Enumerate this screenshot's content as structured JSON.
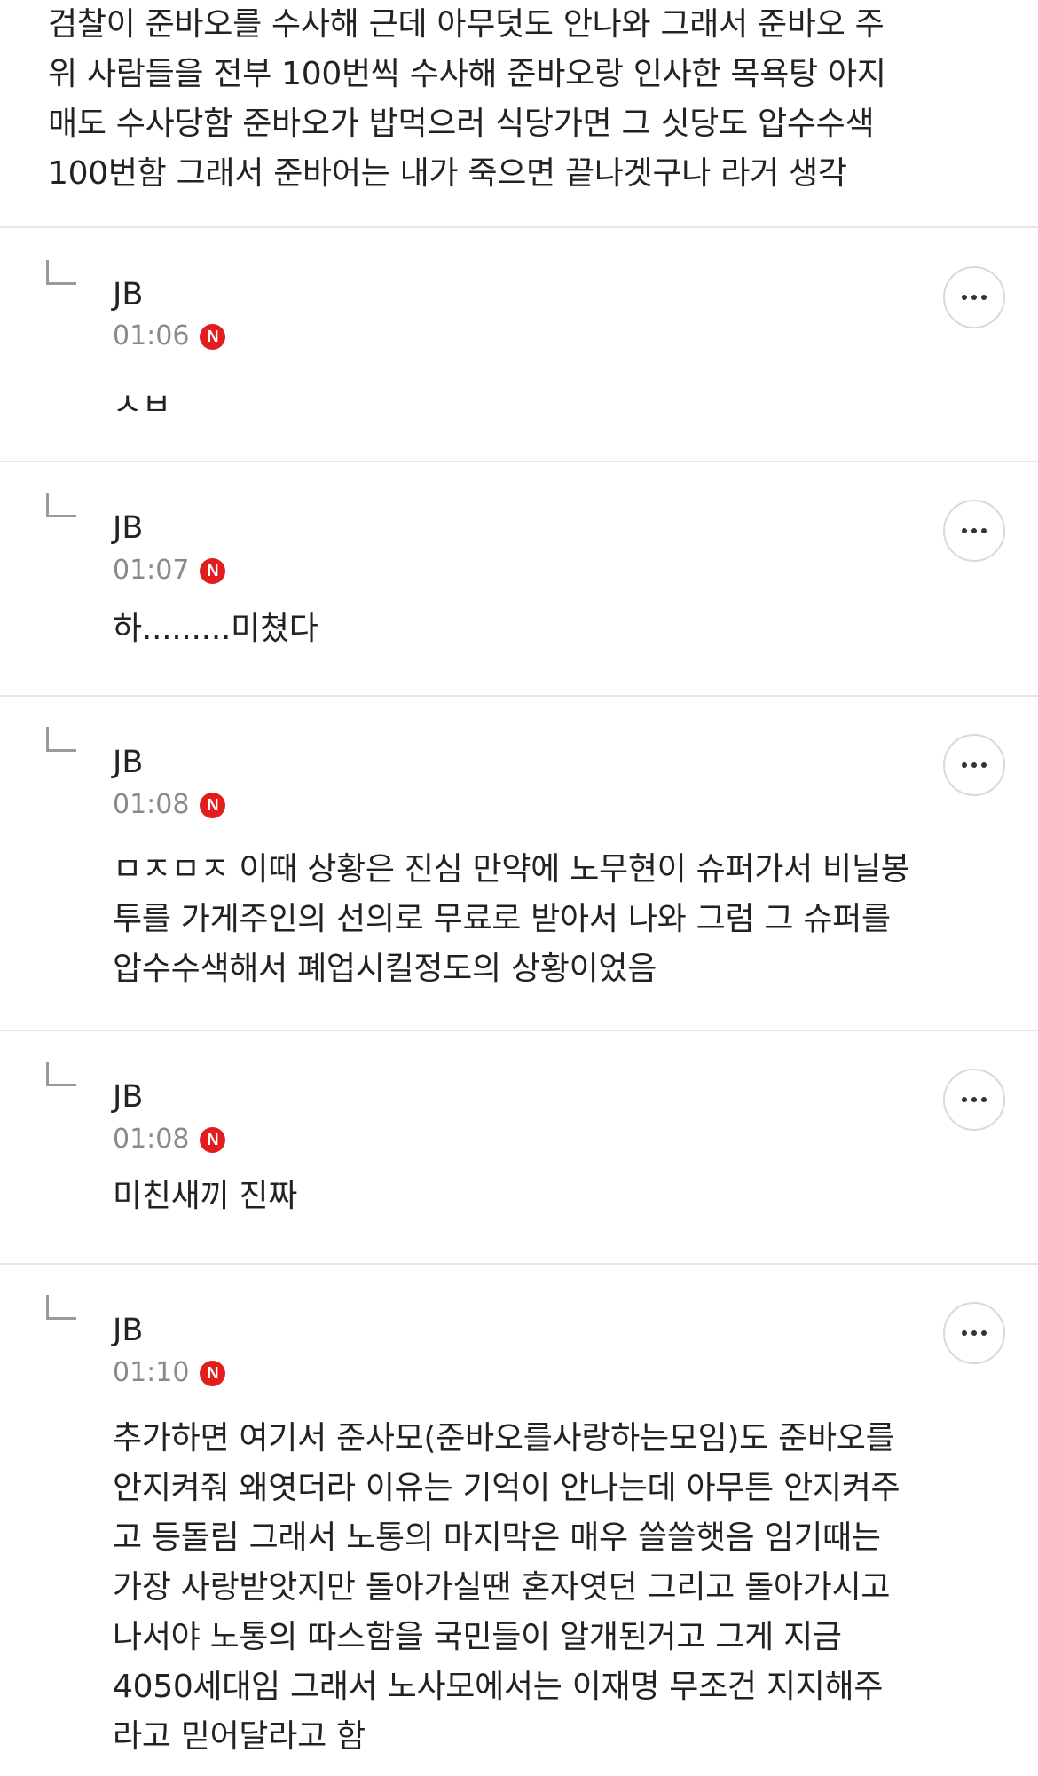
{
  "top_post": {
    "text": "검찰이 준바오를 수사해 근데 아무덧도 안나와 그래서 준바오 주\n위 사람들을 전부 100번씩 수사해 준바오랑 인사한 목욕탕 아지\n매도 수사당함 준바오가 밥먹으러 식당가면 그 싯당도 압수수색\n100번함 그래서 준바어는 내가 죽으면 끝나겟구나 라거 생각"
  },
  "replies": [
    {
      "author": "JB",
      "time": "01:06",
      "badge": "N",
      "text": "ㅅㅂ"
    },
    {
      "author": "JB",
      "time": "01:07",
      "badge": "N",
      "text": "하.........미쳤다"
    },
    {
      "author": "JB",
      "time": "01:08",
      "badge": "N",
      "text": "ㅁㅈㅁㅈ 이때 상황은 진심 만약에 노무현이 슈퍼가서 비닐봉\n투를 가게주인의 선의로 무료로 받아서 나와 그럼 그 슈퍼를\n압수수색해서 폐업시킬정도의 상황이었음"
    },
    {
      "author": "JB",
      "time": "01:08",
      "badge": "N",
      "text": "미친새끼 진짜"
    },
    {
      "author": "JB",
      "time": "01:10",
      "badge": "N",
      "text": "추가하면 여기서 준사모(준바오를사랑하는모임)도 준바오를\n안지켜줘 왜엿더라 이유는 기억이 안나는데 아무튼 안지켜주\n고 등돌림 그래서 노통의 마지막은 매우 쓸쓸햇음 임기때는\n가장 사랑받앗지만 돌아가실땐 혼자엿던 그리고 돌아가시고\n나서야 노통의 따스함을 국민들이 알개된거고 그게 지금\n4050세대임 그래서 노사모에서는 이재명 무조건 지지해주\n라고 믿어달라고 함"
    }
  ],
  "colors": {
    "badge": "#e21d1d",
    "divider": "#e6e6e6",
    "time": "#8a8a8a"
  },
  "icons": {
    "reply_indicator": "reply-arrow-icon",
    "more": "more-options-icon",
    "badge": "new-badge-icon"
  }
}
